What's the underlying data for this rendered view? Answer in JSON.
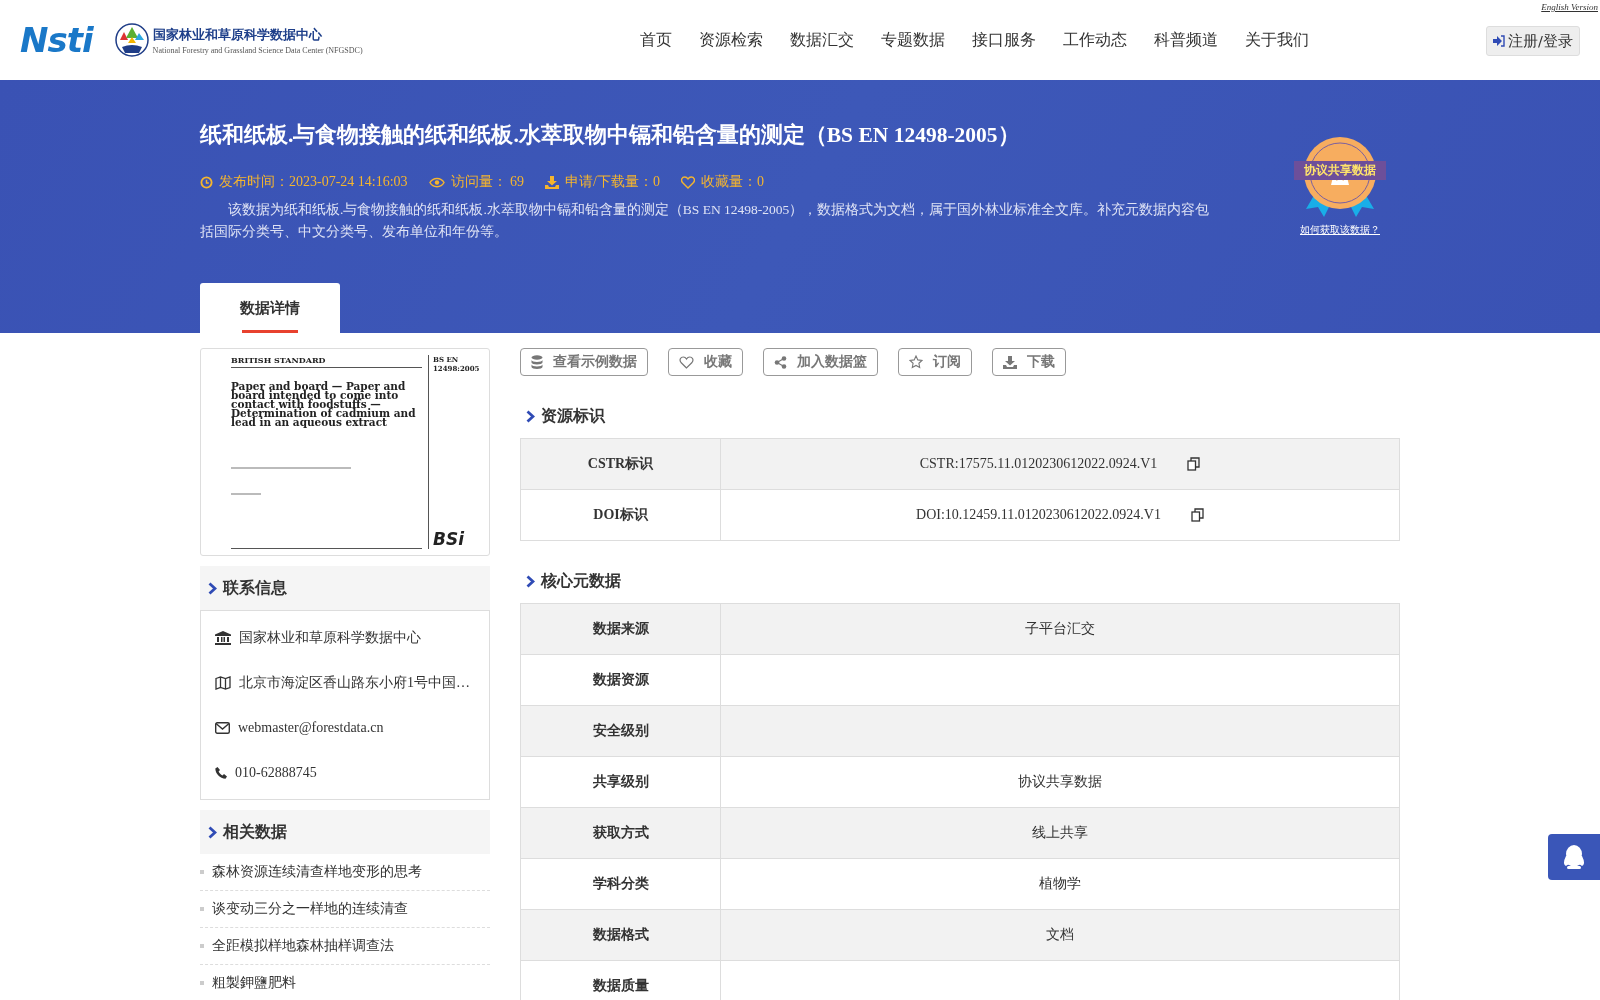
{
  "header": {
    "logo_text": "Nsti",
    "org_name": "国家林业和草原科学数据中心",
    "org_name_en": "National Forestry and Grassland Science Data Center (NFGSDC)",
    "english_link": "English Version",
    "login": "注册/登录",
    "nav": [
      {
        "label": "首页"
      },
      {
        "label": "资源检索"
      },
      {
        "label": "数据汇交"
      },
      {
        "label": "专题数据"
      },
      {
        "label": "接口服务"
      },
      {
        "label": "工作动态"
      },
      {
        "label": "科普频道"
      },
      {
        "label": "关于我们"
      }
    ]
  },
  "banner": {
    "title": "纸和纸板.与食物接触的纸和纸板.水萃取物中镉和铅含量的测定（BS EN 12498-2005）",
    "meta": [
      {
        "kind": "time",
        "text": "发布时间：2023-07-24 14:16:03"
      },
      {
        "kind": "views",
        "text": "访问量： 69"
      },
      {
        "kind": "downloads",
        "text": "申请/下载量：0"
      },
      {
        "kind": "favorites",
        "text": "收藏量：0"
      }
    ],
    "description": "该数据为纸和纸板.与食物接触的纸和纸板.水萃取物中镉和铅含量的测定（BS EN 12498-2005），数据格式为文档，属于国外林业标准全文库。补充元数据内容包括国际分类号、中文分类号、发布单位和年份等。",
    "badge": "协议共享数据",
    "badge_link": "如何获取该数据？",
    "tabs": [
      {
        "label": "数据详情",
        "selected": true
      }
    ]
  },
  "cover": {
    "header": "BRITISH STANDARD",
    "code": "BS EN 12498:2005",
    "title": "Paper and board — Paper and board intended to come into contact with foodstuffs — Determination of cadmium and lead in an aqueous extract",
    "brand": "BSi"
  },
  "contact": {
    "title": "联系信息",
    "items": [
      {
        "kind": "org",
        "text": "国家林业和草原科学数据中心"
      },
      {
        "kind": "address",
        "text": "北京市海淀区香山路东小府1号中国…"
      },
      {
        "kind": "email",
        "text": "webmaster@forestdata.cn"
      },
      {
        "kind": "phone",
        "text": "010-62888745"
      }
    ]
  },
  "related": {
    "title": "相关数据",
    "items": [
      {
        "text": "森林资源连续清查样地变形的思考"
      },
      {
        "text": "谈变动三分之一样地的连续清查"
      },
      {
        "text": "全距模拟样地森林抽样调查法"
      },
      {
        "text": "粗製鉀鹽肥料"
      }
    ]
  },
  "actions": [
    {
      "kind": "sample",
      "label": "查看示例数据"
    },
    {
      "kind": "favorite",
      "label": "收藏"
    },
    {
      "kind": "basket",
      "label": "加入数据篮"
    },
    {
      "kind": "subscribe",
      "label": "订阅"
    },
    {
      "kind": "download",
      "label": "下载"
    }
  ],
  "identifiers": {
    "title": "资源标识",
    "rows": [
      {
        "label": "CSTR标识",
        "value": "CSTR:17575.11.0120230612022.0924.V1"
      },
      {
        "label": "DOI标识",
        "value": "DOI:10.12459.11.0120230612022.0924.V1"
      }
    ]
  },
  "core": {
    "title": "核心元数据",
    "rows": [
      {
        "label": "数据来源",
        "value": "子平台汇交"
      },
      {
        "label": "数据资源"
      },
      {
        "label": "安全级别"
      },
      {
        "label": "共享级别",
        "value": "协议共享数据"
      },
      {
        "label": "获取方式",
        "value": "线上共享"
      },
      {
        "label": "学科分类",
        "value": "植物学"
      },
      {
        "label": "数据格式",
        "value": "文档"
      },
      {
        "label": "数据质量"
      }
    ]
  }
}
